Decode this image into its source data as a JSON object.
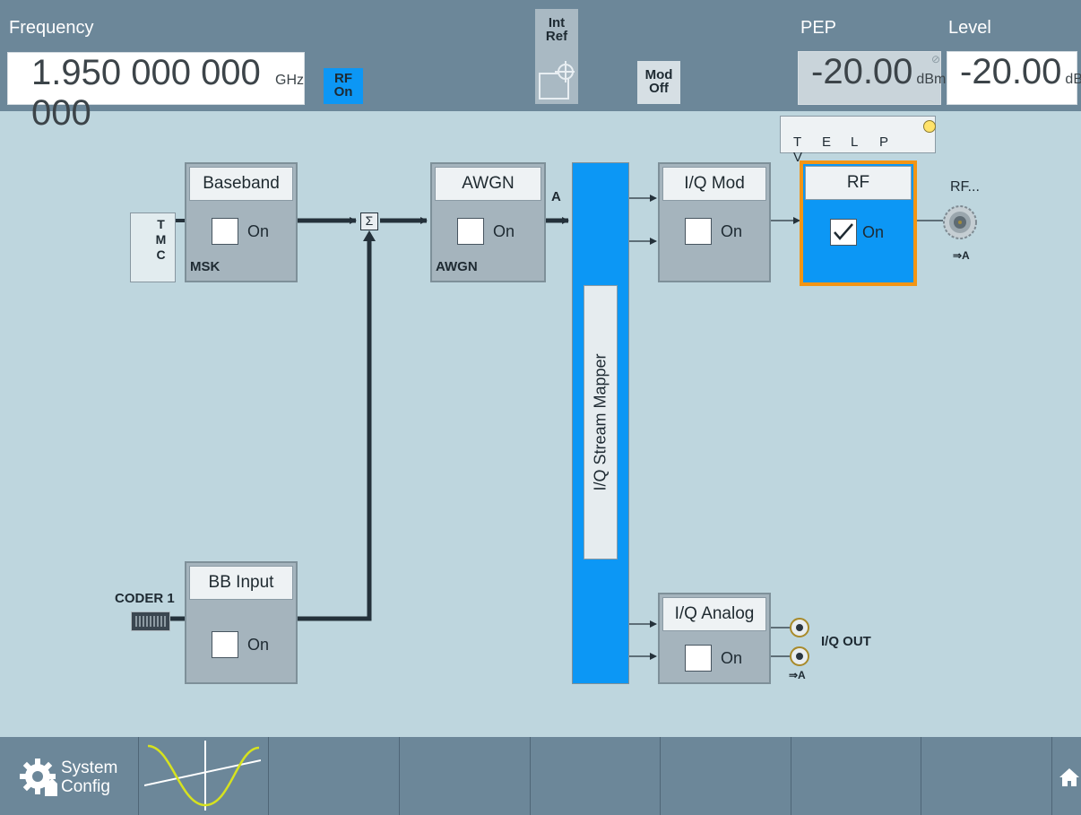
{
  "header": {
    "frequency_label": "Frequency",
    "frequency_value": "1.950 000 000 000",
    "frequency_unit": "GHz",
    "rf_badge_line1": "RF",
    "rf_badge_line2": "On",
    "intref_line1": "Int",
    "intref_line2": "Ref",
    "mod_line1": "Mod",
    "mod_line2": "Off",
    "pep_label": "PEP",
    "pep_value": "-20.00",
    "pep_unit": "dBm",
    "level_label": "Level",
    "level_value": "-20.00",
    "level_unit": "dBm"
  },
  "diagram": {
    "tmc": [
      "T",
      "M",
      "C"
    ],
    "baseband": {
      "title": "Baseband",
      "on_label": "On",
      "sub": "MSK",
      "checked": false
    },
    "sum_symbol": "Σ",
    "awgn": {
      "title": "AWGN",
      "on_label": "On",
      "sub": "AWGN",
      "checked": false
    },
    "path_label": "A",
    "stream_mapper": "I/Q Stream Mapper",
    "iqmod": {
      "title": "I/Q Mod",
      "on_label": "On",
      "checked": false
    },
    "rf": {
      "title": "RF",
      "on_label": "On",
      "checked": true
    },
    "telpv": [
      "T",
      "E",
      "L",
      "P",
      "V"
    ],
    "rf_connector_label": "RF...",
    "rf_connector_sub": "⇒A",
    "coder_label": "CODER 1",
    "bbinput": {
      "title": "BB Input",
      "on_label": "On",
      "checked": false
    },
    "iqanalog": {
      "title": "I/Q Analog",
      "on_label": "On",
      "checked": false
    },
    "iqout_label": "I/Q OUT",
    "iqout_sub": "⇒A"
  },
  "softkeys": {
    "system_config_line1": "System",
    "system_config_line2": "Config"
  },
  "colors": {
    "accent_blue": "#0c97f5",
    "highlight_orange": "#f39514",
    "indicator_yellow": "#ffe36b"
  }
}
